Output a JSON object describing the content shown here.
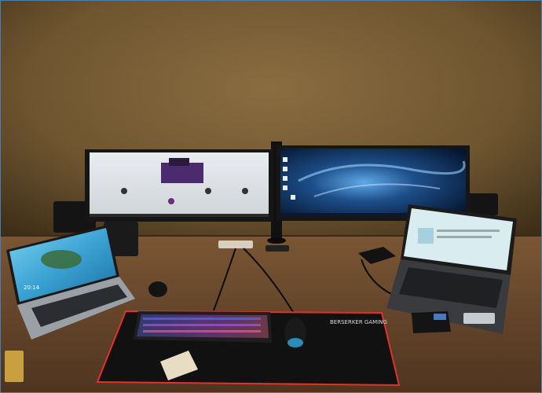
{
  "photo": {
    "mousepad_brand": "BERSERKER GAMING",
    "left_laptop_time": "20:14",
    "colors": {
      "wall": "#7c6238",
      "desk": "#6b4a2c",
      "mousepad": "#111111",
      "mousepad_edge": "#e0322a",
      "monitor_bezel": "#161616",
      "space_wallpaper": "#1d4f8a",
      "sea_wallpaper": "#3aa3d4"
    }
  }
}
